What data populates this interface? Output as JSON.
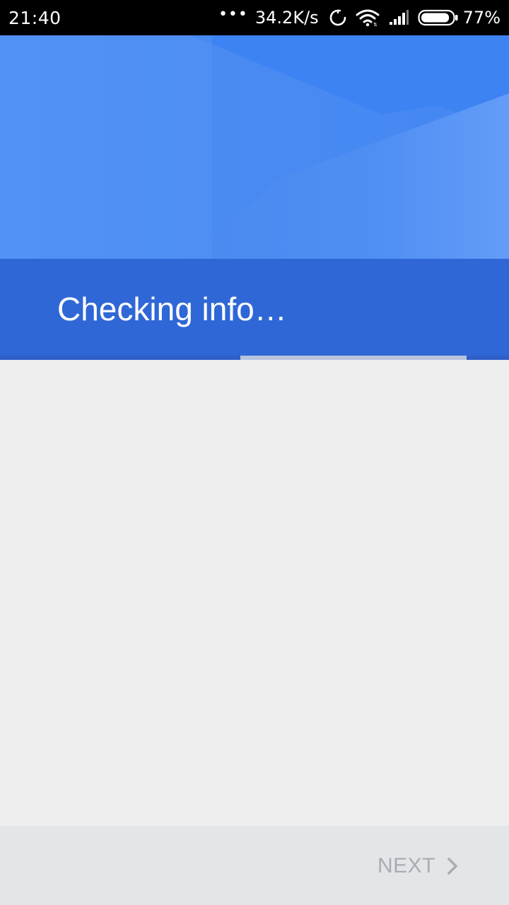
{
  "status_bar": {
    "time": "21:40",
    "dots": "•••",
    "speed": "34.2K/s",
    "battery_percent": "77%",
    "icons": [
      "sync-icon",
      "wifi-icon",
      "signal-icon",
      "battery-icon"
    ],
    "battery_level": 0.77
  },
  "header": {
    "title": "Checking info…",
    "progress": 0.45
  },
  "footer": {
    "next_label": "NEXT",
    "next_icon": "chevron-right-icon"
  },
  "colors": {
    "header_blue": "#4a8af1",
    "band_blue": "#2f67d6",
    "background": "#eeeeee",
    "footer": "#e2e6e9",
    "disabled_text": "#a9adb0"
  }
}
